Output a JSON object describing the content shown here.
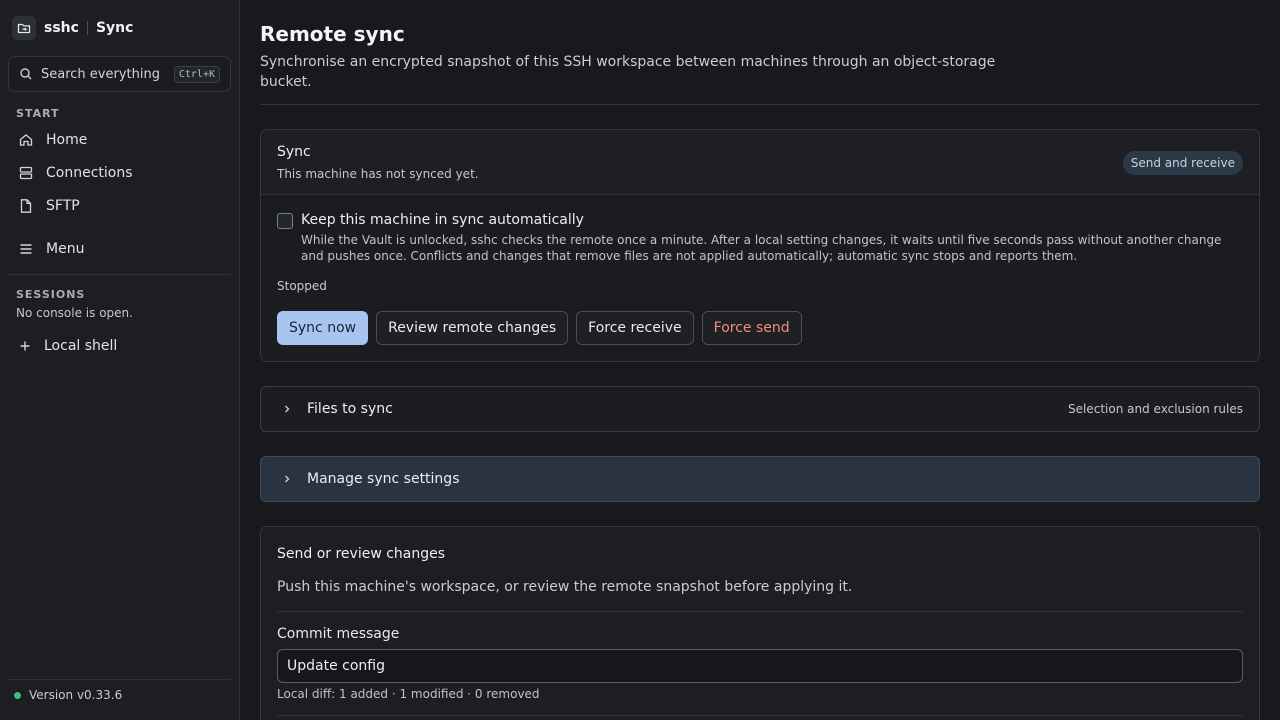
{
  "sidebar": {
    "app_name": "sshc",
    "page_name": "Sync",
    "search": {
      "label": "Search everything",
      "shortcut": "Ctrl+K"
    },
    "start_label": "START",
    "nav": [
      {
        "label": "Home",
        "icon": "home-icon"
      },
      {
        "label": "Connections",
        "icon": "server-icon"
      },
      {
        "label": "SFTP",
        "icon": "file-icon"
      },
      {
        "label": "Menu",
        "icon": "menu-icon"
      }
    ],
    "sessions_label": "SESSIONS",
    "no_console": "No console is open.",
    "local_shell": "Local shell",
    "version": "Version v0.33.6"
  },
  "main": {
    "title": "Remote sync",
    "description": "Synchronise an encrypted snapshot of this SSH workspace between machines through an object-storage bucket.",
    "sync_card": {
      "title": "Sync",
      "subtitle": "This machine has not synced yet.",
      "mode_badge": "Send and receive",
      "auto_sync_label": "Keep this machine in sync automatically",
      "auto_sync_checked": false,
      "auto_sync_help": "While the Vault is unlocked, sshc checks the remote once a minute. After a local setting changes, it waits until five seconds pass without another change and pushes once. Conflicts and changes that remove files are not applied automatically; automatic sync stops and reports them.",
      "status": "Stopped",
      "buttons": {
        "sync_now": "Sync now",
        "review": "Review remote changes",
        "force_receive": "Force receive",
        "force_send": "Force send"
      }
    },
    "files_to_sync": {
      "title": "Files to sync",
      "meta": "Selection and exclusion rules"
    },
    "manage_settings": {
      "title": "Manage sync settings"
    },
    "send_card": {
      "title": "Send or review changes",
      "description": "Push this machine's workspace, or review the remote snapshot before applying it.",
      "commit_label": "Commit message",
      "commit_value": "Update config",
      "diff": "Local diff: 1 added · 1 modified · 0 removed"
    }
  },
  "colors": {
    "accent": "#a9c5ef",
    "danger": "#f28b82",
    "status_ok": "#3fbf7f",
    "background": "#17191d"
  }
}
